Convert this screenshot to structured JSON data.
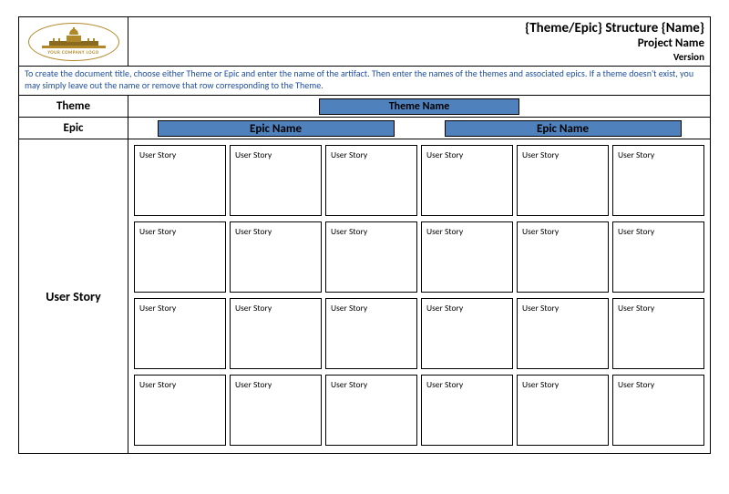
{
  "header": {
    "logo_text": "YOUR COMPANY LOGO",
    "title_line1": "{Theme/Epic} Structure {Name}",
    "title_line2": "Project Name",
    "title_line3": "Version"
  },
  "instructions": "To create the document title, choose either Theme or Epic and enter the name of the artifact. Then enter the names of the themes and associated epics.  If a theme doesn't exist, you may simply leave out the name or remove that row corresponding to the Theme.",
  "labels": {
    "theme": "Theme",
    "epic": "Epic",
    "user_story": "User Story"
  },
  "theme_name": "Theme Name",
  "epics": [
    {
      "name": "Epic Name"
    },
    {
      "name": "Epic Name"
    }
  ],
  "card_label": "User Story",
  "grid": {
    "rows": 4,
    "cols_per_epic": 3,
    "epics_count": 2
  }
}
